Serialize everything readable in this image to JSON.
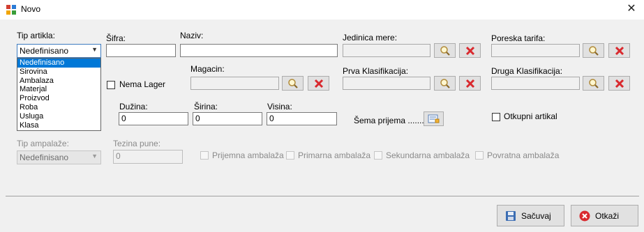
{
  "window": {
    "title": "Novo",
    "close_icon": "close-icon"
  },
  "fields": {
    "tip_artikla": {
      "label": "Tip artikla:",
      "selected": "Nedefinisano",
      "options": [
        "Nedefinisano",
        "Sirovina",
        "Ambalaza",
        "Materjal",
        "Proizvod",
        "Roba",
        "Usluga",
        "Klasa"
      ]
    },
    "sifra": {
      "label": "Šifra:",
      "value": ""
    },
    "naziv": {
      "label": "Naziv:",
      "value": ""
    },
    "jedinica_mere": {
      "label": "Jedinica mere:",
      "value": ""
    },
    "poreska_tarifa": {
      "label": "Poreska tarifa:",
      "value": ""
    },
    "nema_lager": {
      "label": "Nema Lager",
      "checked": false
    },
    "magacin": {
      "label": "Magacin:",
      "value": ""
    },
    "prva_klasifikacija": {
      "label": "Prva Klasifikacija:",
      "value": ""
    },
    "druga_klasifikacija": {
      "label": "Druga Klasifikacija:",
      "value": ""
    },
    "duzina": {
      "label": "Dužina:",
      "value": "0"
    },
    "sirina": {
      "label": "Širina:",
      "value": "0"
    },
    "visina": {
      "label": "Visina:",
      "value": "0"
    },
    "sema_prijema": {
      "label": "Šema prijema ......."
    },
    "otkupni_artikal": {
      "label": "Otkupni artikal",
      "checked": false
    },
    "tip_ambalaze": {
      "label": "Tip ampalaže:",
      "selected": "Nedefinisano"
    },
    "tezina_pune": {
      "label": "Tezina pune:",
      "value": "0"
    },
    "prijemna_ambalaza": {
      "label": "Prijemna ambalaža"
    },
    "primarna_ambalaza": {
      "label": "Primarna ambalaža"
    },
    "sekundarna_ambalaza": {
      "label": "Sekundarna ambalaža"
    },
    "povratna_ambalaza": {
      "label": "Povratna ambalaža"
    }
  },
  "buttons": {
    "save": "Sačuvaj",
    "cancel": "Otkaži"
  },
  "colors": {
    "accent": "#0078d7",
    "delete_red": "#d9292e"
  }
}
